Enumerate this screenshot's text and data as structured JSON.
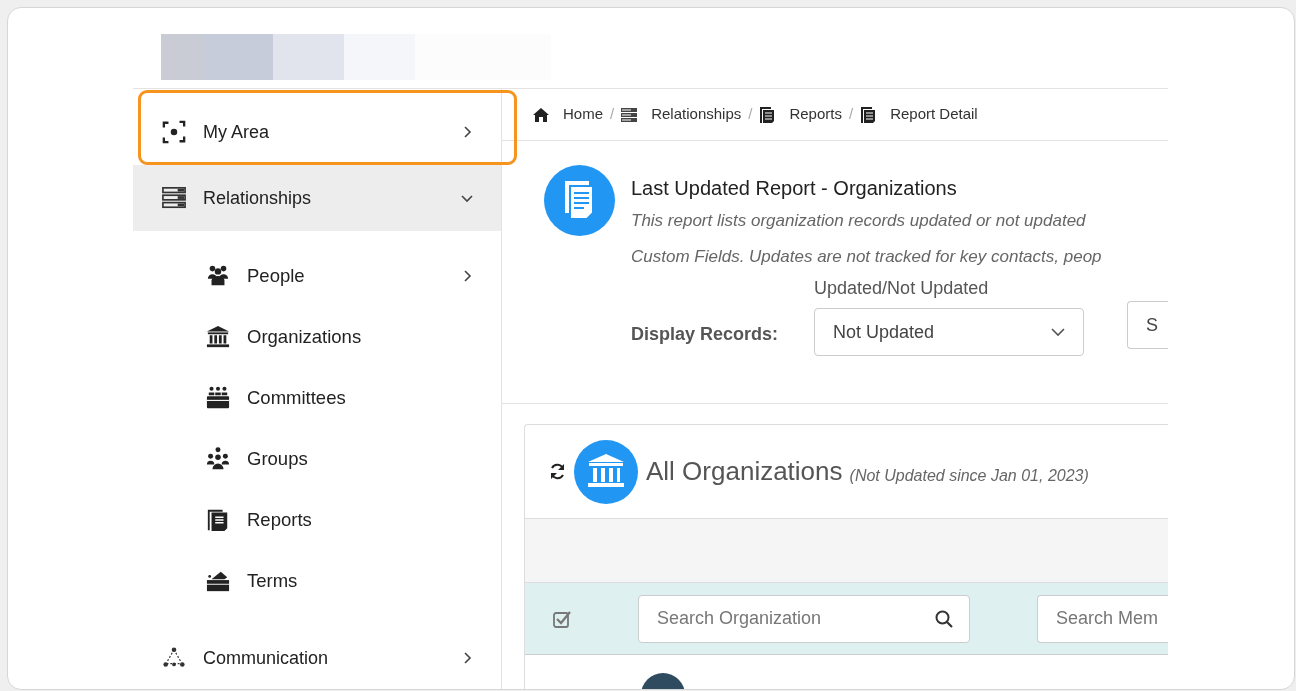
{
  "sidebar": {
    "items": [
      {
        "label": "My Area",
        "selected": false,
        "highlighted": true,
        "expanded": false
      },
      {
        "label": "Relationships",
        "selected": true,
        "highlighted": false,
        "expanded": true,
        "children": [
          {
            "label": "People",
            "selected": false,
            "expanded": false
          },
          {
            "label": "Organizations",
            "selected": false
          },
          {
            "label": "Committees",
            "selected": false
          },
          {
            "label": "Groups",
            "selected": false
          },
          {
            "label": "Reports",
            "selected": false
          },
          {
            "label": "Terms",
            "selected": false
          }
        ]
      },
      {
        "label": "Communication",
        "selected": false,
        "highlighted": false,
        "expanded": false
      }
    ]
  },
  "breadcrumb": [
    {
      "label": "Home"
    },
    {
      "separator": "/",
      "label": "Relationships"
    },
    {
      "separator": "/",
      "label": "Reports"
    },
    {
      "separator": "/",
      "label": "Report Detail"
    }
  ],
  "report": {
    "title": "Last Updated Report - Organizations",
    "description_lines": [
      "This report lists organization records updated or not updated",
      "Custom Fields. Updates are not tracked for key contacts, peop"
    ],
    "filter_label": "Display Records:",
    "select_label": "Updated/Not Updated",
    "select_value": "Not Updated",
    "second_field_text": "S"
  },
  "list": {
    "title": "All Organizations",
    "subtitle": "(Not Updated since Jan 01, 2023)",
    "search_fields": [
      {
        "placeholder": "Search Organization",
        "has_icon": true
      },
      {
        "placeholder": "Search Mem",
        "has_icon": false
      }
    ]
  }
}
